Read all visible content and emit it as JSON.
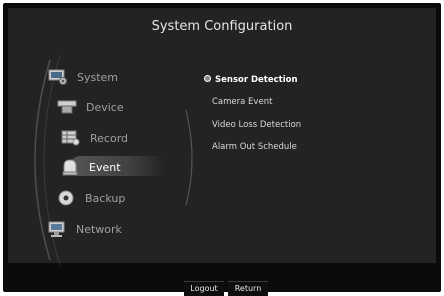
{
  "header": {
    "title": "System Configuration"
  },
  "sidebar": {
    "items": [
      {
        "label": "System",
        "icon": "monitor-gear-icon"
      },
      {
        "label": "Device",
        "icon": "camera-icon"
      },
      {
        "label": "Record",
        "icon": "record-grid-icon"
      },
      {
        "label": "Event",
        "icon": "alarm-bell-icon",
        "active": true
      },
      {
        "label": "Backup",
        "icon": "disc-icon"
      },
      {
        "label": "Network",
        "icon": "network-monitor-icon"
      }
    ]
  },
  "submenu": {
    "items": [
      {
        "label": "Sensor Detection",
        "selected": true
      },
      {
        "label": "Camera Event"
      },
      {
        "label": "Video Loss Detection"
      },
      {
        "label": "Alarm Out Schedule"
      }
    ]
  },
  "footer": {
    "logout_label": "Logout",
    "return_label": "Return"
  },
  "colors": {
    "background": "#232323",
    "frame": "#0b0b0b",
    "text": "#a0a0a0",
    "active_text": "#ffffff"
  }
}
